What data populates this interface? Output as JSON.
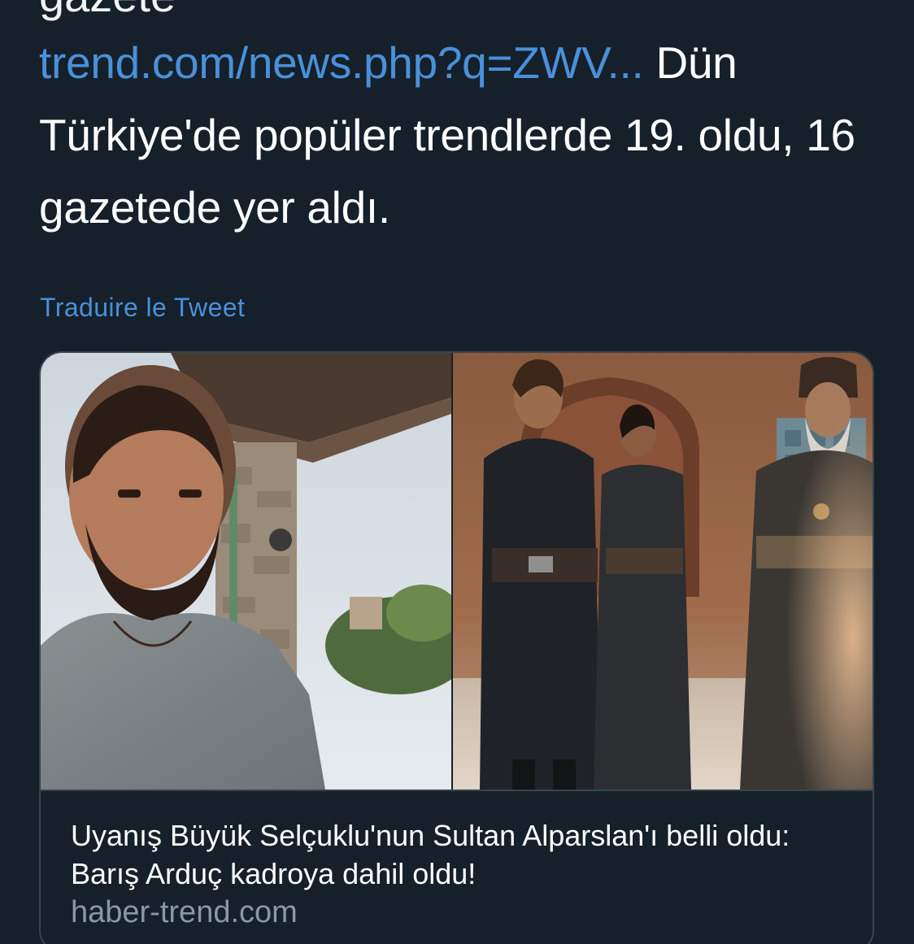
{
  "tweet": {
    "cut_line_prefix": "gazete",
    "cut_line_link": "trend.com/",
    "link_text": "trend.com/news.php?q=ZWV...",
    "body_text": "Dün Türkiye'de popüler trendlerde 19. oldu, 16 gazetede yer aldı.",
    "translate_label": "Traduire le Tweet"
  },
  "card": {
    "title": "Uyanış Büyük Selçuklu'nun Sultan Alparslan'ı belli oldu: Barış Arduç kadroya dahil oldu!",
    "domain": "haber-trend.com"
  },
  "colors": {
    "background": "#15202b",
    "link": "#4a90d9",
    "border": "#38444d",
    "muted": "#8899a6"
  }
}
